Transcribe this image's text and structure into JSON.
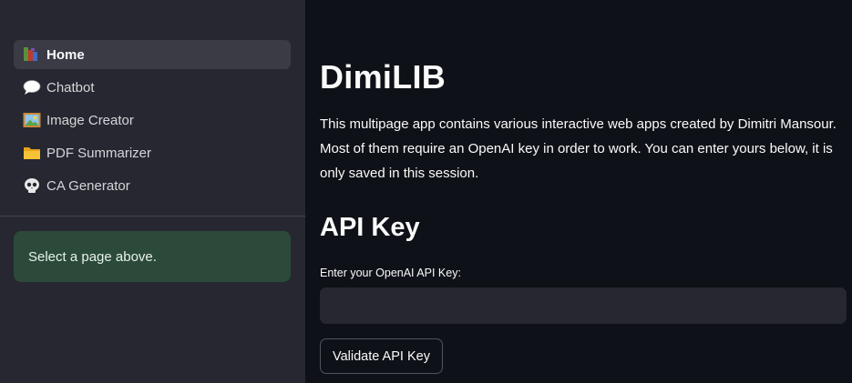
{
  "sidebar": {
    "items": [
      {
        "label": "Home",
        "icon": "books-icon",
        "active": true
      },
      {
        "label": "Chatbot",
        "icon": "speech-bubble-icon",
        "active": false
      },
      {
        "label": "Image Creator",
        "icon": "framed-picture-icon",
        "active": false
      },
      {
        "label": "PDF Summarizer",
        "icon": "folder-icon",
        "active": false
      },
      {
        "label": "CA Generator",
        "icon": "skull-icon",
        "active": false
      }
    ],
    "info": "Select a page above."
  },
  "main": {
    "title": "DimiLIB",
    "description": "This multipage app contains various interactive web apps created by Dimitri Mansour. Most of them require an OpenAI key in order to work. You can enter yours below, it is only saved in this session.",
    "section_title": "API Key",
    "input_label": "Enter your OpenAI API Key:",
    "input_value": "",
    "button_label": "Validate API Key"
  },
  "colors": {
    "sidebar_bg": "#262730",
    "main_bg": "#0e1117",
    "active_item_bg": "#3a3b45",
    "info_bg": "#2c4a3a"
  }
}
